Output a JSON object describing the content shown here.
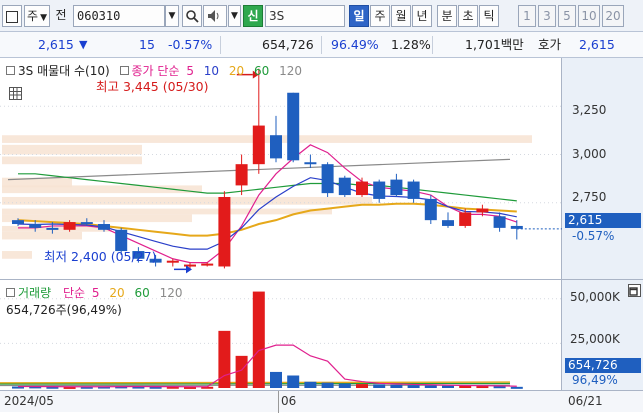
{
  "toolbar": {
    "square_icon": "square-icon",
    "market_select": "주",
    "prev_label": "전",
    "stock_code": "060310",
    "stock_name": "3S",
    "new_badge": "신",
    "periods": [
      "일",
      "주",
      "월",
      "년",
      "분",
      "초",
      "틱"
    ],
    "active_period": "일",
    "intervals": [
      "1",
      "3",
      "5",
      "10",
      "20"
    ],
    "colors": {
      "active": "#2e64c6",
      "badge": "#2ea84e"
    }
  },
  "status": {
    "price": "2,615",
    "change_arrow": "▼",
    "change": "15",
    "change_pct": "-0.57%",
    "volume": "654,726",
    "vol_ratio": "96.49%",
    "turnover": "1.28%",
    "trade_value": "1,701백만",
    "quote_label": "호가",
    "quote_price": "2,615"
  },
  "price_panel": {
    "legend": {
      "series": "3S 매물대 수(10)",
      "ma_label": "종가 단순",
      "periods": [
        "5",
        "10",
        "20",
        "60",
        "120"
      ],
      "colors": [
        "#e0208e",
        "#2a3fc9",
        "#e6a81a",
        "#1f9b3a",
        "#8a8a8a"
      ]
    },
    "high_note": "최고 3,445 (05/30)",
    "low_note": "최저 2,400 (05/27)",
    "axis_ticks": [
      "3,250",
      "3,000",
      "2,750"
    ],
    "current_tag": "2,615",
    "current_pct": "-0.57%",
    "grid_icon": "grid-icon"
  },
  "volume_panel": {
    "legend": {
      "title": "거래량",
      "ma_label": "단순",
      "periods": [
        "5",
        "20",
        "60",
        "120"
      ],
      "colors": [
        "#e0208e",
        "#e6a81a",
        "#1f9b3a",
        "#8a8a8a"
      ]
    },
    "volume_text": "654,726주(96,49%)",
    "axis_ticks": [
      "50,000K",
      "25,000K"
    ],
    "current_tag": "654,726",
    "current_pct": "96,49%",
    "maximize_icon": "maximize-icon"
  },
  "date_axis": {
    "labels": [
      "2024/05",
      "06",
      "06/21"
    ]
  },
  "chart_data": {
    "type": "candlestick",
    "ylim": [
      2350,
      3500
    ],
    "up_color": "#e21b1b",
    "down_color": "#1f5fbf",
    "candles": [
      {
        "o": 2660,
        "h": 2670,
        "l": 2630,
        "c": 2640
      },
      {
        "o": 2640,
        "h": 2660,
        "l": 2600,
        "c": 2620
      },
      {
        "o": 2620,
        "h": 2650,
        "l": 2590,
        "c": 2610
      },
      {
        "o": 2610,
        "h": 2660,
        "l": 2600,
        "c": 2650
      },
      {
        "o": 2650,
        "h": 2670,
        "l": 2630,
        "c": 2640
      },
      {
        "o": 2640,
        "h": 2660,
        "l": 2600,
        "c": 2610
      },
      {
        "o": 2610,
        "h": 2620,
        "l": 2480,
        "c": 2500
      },
      {
        "o": 2500,
        "h": 2520,
        "l": 2440,
        "c": 2460
      },
      {
        "o": 2460,
        "h": 2480,
        "l": 2420,
        "c": 2440
      },
      {
        "o": 2440,
        "h": 2460,
        "l": 2420,
        "c": 2450
      },
      {
        "o": 2420,
        "h": 2440,
        "l": 2400,
        "c": 2430
      },
      {
        "o": 2430,
        "h": 2440,
        "l": 2420,
        "c": 2435
      },
      {
        "o": 2420,
        "h": 2810,
        "l": 2410,
        "c": 2780
      },
      {
        "o": 2840,
        "h": 3000,
        "l": 2790,
        "c": 2950
      },
      {
        "o": 2950,
        "h": 3445,
        "l": 2900,
        "c": 3150
      },
      {
        "o": 3100,
        "h": 3200,
        "l": 2960,
        "c": 2980
      },
      {
        "o": 3320,
        "h": 3320,
        "l": 2960,
        "c": 2970
      },
      {
        "o": 2960,
        "h": 3000,
        "l": 2930,
        "c": 2950
      },
      {
        "o": 2950,
        "h": 2960,
        "l": 2780,
        "c": 2800
      },
      {
        "o": 2880,
        "h": 2890,
        "l": 2780,
        "c": 2790
      },
      {
        "o": 2790,
        "h": 2880,
        "l": 2780,
        "c": 2860
      },
      {
        "o": 2860,
        "h": 2870,
        "l": 2750,
        "c": 2770
      },
      {
        "o": 2870,
        "h": 2900,
        "l": 2780,
        "c": 2790
      },
      {
        "o": 2860,
        "h": 2870,
        "l": 2750,
        "c": 2770
      },
      {
        "o": 2770,
        "h": 2790,
        "l": 2640,
        "c": 2660
      },
      {
        "o": 2660,
        "h": 2700,
        "l": 2620,
        "c": 2630
      },
      {
        "o": 2630,
        "h": 2720,
        "l": 2620,
        "c": 2700
      },
      {
        "o": 2700,
        "h": 2740,
        "l": 2680,
        "c": 2720
      },
      {
        "o": 2680,
        "h": 2700,
        "l": 2600,
        "c": 2620
      },
      {
        "o": 2630,
        "h": 2660,
        "l": 2560,
        "c": 2615
      }
    ],
    "volume_ylim": [
      0,
      56000
    ],
    "volume": [
      800,
      900,
      700,
      600,
      700,
      800,
      900,
      800,
      700,
      700,
      600,
      700,
      32000,
      18000,
      54000,
      9000,
      7000,
      3500,
      3000,
      2500,
      2200,
      2000,
      1800,
      1600,
      1400,
      1300,
      1200,
      1100,
      1000,
      650
    ],
    "ma5": [
      2620,
      2620,
      2630,
      2630,
      2630,
      2620,
      2580,
      2540,
      2500,
      2460,
      2440,
      2440,
      2510,
      2630,
      2790,
      2900,
      2980,
      3050,
      3010,
      2930,
      2860,
      2830,
      2820,
      2810,
      2790,
      2730,
      2690,
      2690,
      2680,
      2650
    ],
    "ma20": [
      2660,
      2655,
      2650,
      2645,
      2640,
      2630,
      2620,
      2610,
      2600,
      2590,
      2580,
      2580,
      2590,
      2610,
      2640,
      2660,
      2690,
      2710,
      2720,
      2730,
      2740,
      2740,
      2745,
      2745,
      2740,
      2730,
      2720,
      2715,
      2710,
      2705
    ],
    "ma60": [
      2900,
      2900,
      2890,
      2880,
      2870,
      2860,
      2850,
      2840,
      2830,
      2820,
      2810,
      2800,
      2800,
      2810,
      2820,
      2830,
      2840,
      2850,
      2850,
      2850,
      2840,
      2840,
      2830,
      2820,
      2810,
      2800,
      2790,
      2780,
      2770,
      2760
    ],
    "vol_ma5": [
      800,
      800,
      750,
      720,
      700,
      720,
      760,
      800,
      780,
      750,
      720,
      700,
      7000,
      10000,
      21000,
      24000,
      24000,
      18000,
      15000,
      5000,
      3600,
      2600,
      2300,
      2000,
      1800,
      1600,
      1400,
      1300,
      1200,
      1000
    ]
  }
}
